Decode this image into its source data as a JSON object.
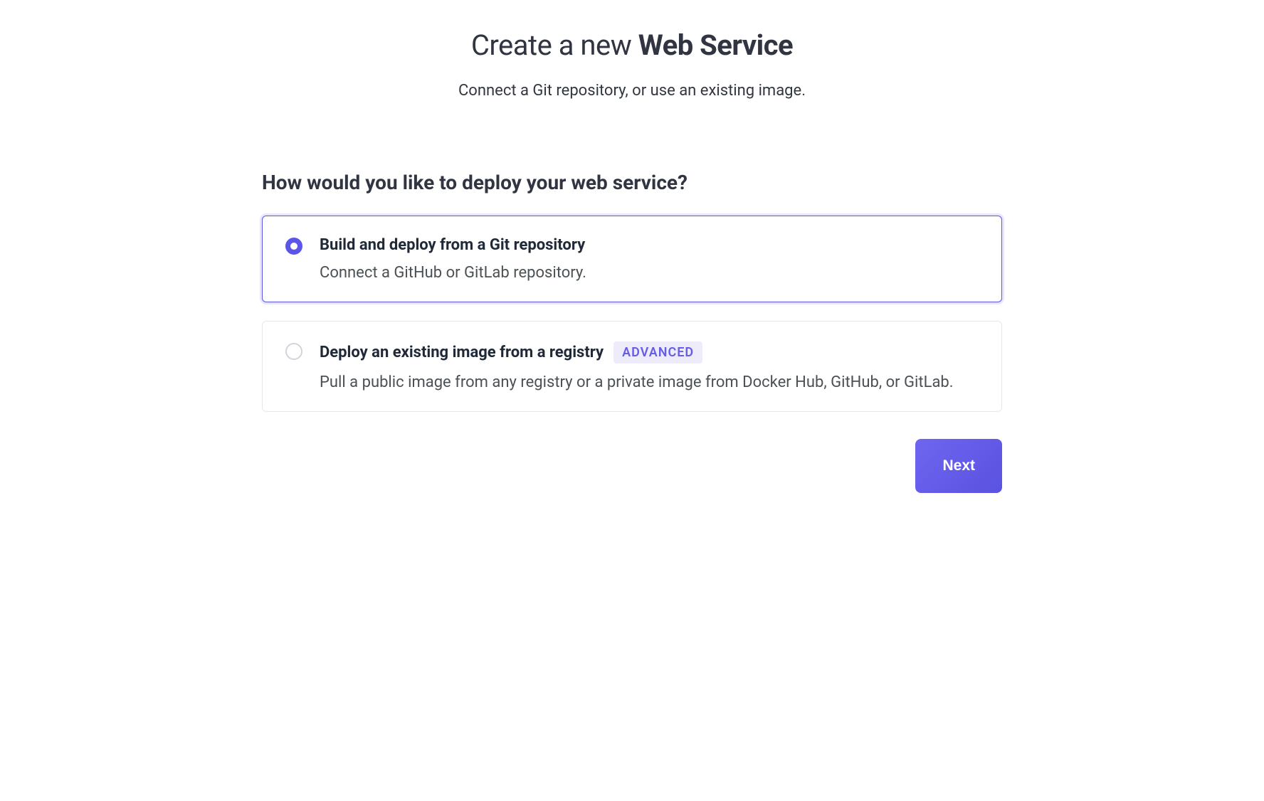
{
  "header": {
    "title_prefix": "Create a new ",
    "title_bold": "Web Service",
    "subtitle": "Connect a Git repository, or use an existing image."
  },
  "section": {
    "heading": "How would you like to deploy your web service?"
  },
  "options": [
    {
      "title": "Build and deploy from a Git repository",
      "description": "Connect a GitHub or GitLab repository.",
      "badge": null,
      "selected": true
    },
    {
      "title": "Deploy an existing image from a registry",
      "description": "Pull a public image from any registry or a private image from Docker Hub, GitHub, or GitLab.",
      "badge": "ADVANCED",
      "selected": false
    }
  ],
  "footer": {
    "next_label": "Next"
  }
}
